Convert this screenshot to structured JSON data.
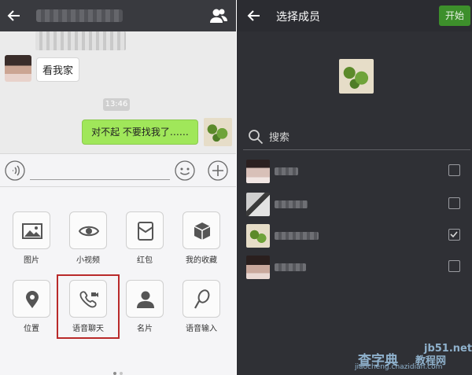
{
  "left": {
    "chat": {
      "received_message": "看我家",
      "time": "13:46",
      "sent_message": "对不起  不要找我了……"
    },
    "features": [
      {
        "label": "图片",
        "icon": "image-icon"
      },
      {
        "label": "小视频",
        "icon": "eye-icon"
      },
      {
        "label": "红包",
        "icon": "red-packet-icon"
      },
      {
        "label": "我的收藏",
        "icon": "cube-icon"
      },
      {
        "label": "位置",
        "icon": "location-pin-icon"
      },
      {
        "label": "语音聊天",
        "icon": "phone-video-icon"
      },
      {
        "label": "名片",
        "icon": "person-card-icon"
      },
      {
        "label": "语音输入",
        "icon": "microphone-icon"
      }
    ]
  },
  "right": {
    "title": "选择成员",
    "start_button": "开始",
    "search_placeholder": "搜索",
    "members": [
      {
        "checked": false
      },
      {
        "checked": false
      },
      {
        "checked": true
      },
      {
        "checked": false
      }
    ]
  },
  "watermark": {
    "site": "jb51.net",
    "brand": "查字典",
    "tutorial": "教程网",
    "domain": "jiaocheng.chazidian.com"
  },
  "colors": {
    "header_dark": "#393a3f",
    "sent_bubble": "#a0e75a",
    "start_button": "#3d8f2b",
    "highlight_box": "#b92a2a"
  }
}
